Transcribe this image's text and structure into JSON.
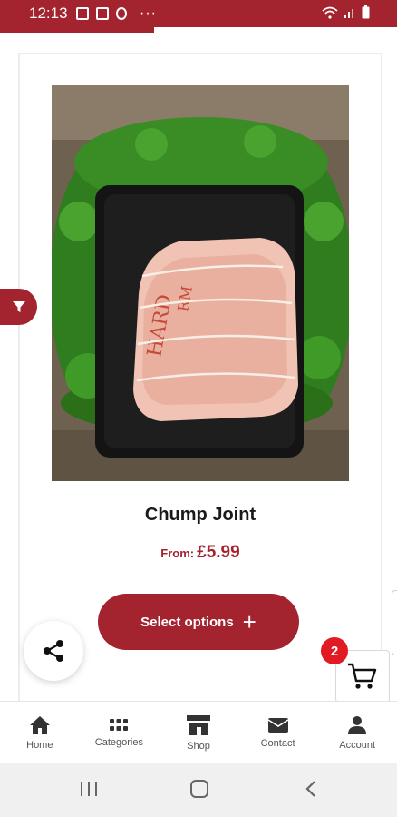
{
  "status_bar": {
    "time": "12:13",
    "dots": "···"
  },
  "product": {
    "name": "Chump Joint",
    "from_label": "From:",
    "price": "£5.99",
    "image_label": "Rolled pork chump joint on black tray"
  },
  "actions": {
    "select_options_label": "Select options",
    "plus_symbol": "+"
  },
  "cart": {
    "count": "2"
  },
  "bottom_nav": [
    {
      "label": "Home",
      "icon": "home-icon"
    },
    {
      "label": "Categories",
      "icon": "grid-icon"
    },
    {
      "label": "Shop",
      "icon": "store-icon"
    },
    {
      "label": "Contact",
      "icon": "envelope-icon"
    },
    {
      "label": "Account",
      "icon": "user-icon"
    }
  ],
  "colors": {
    "brand": "#a3232f",
    "badge": "#e01b24"
  }
}
